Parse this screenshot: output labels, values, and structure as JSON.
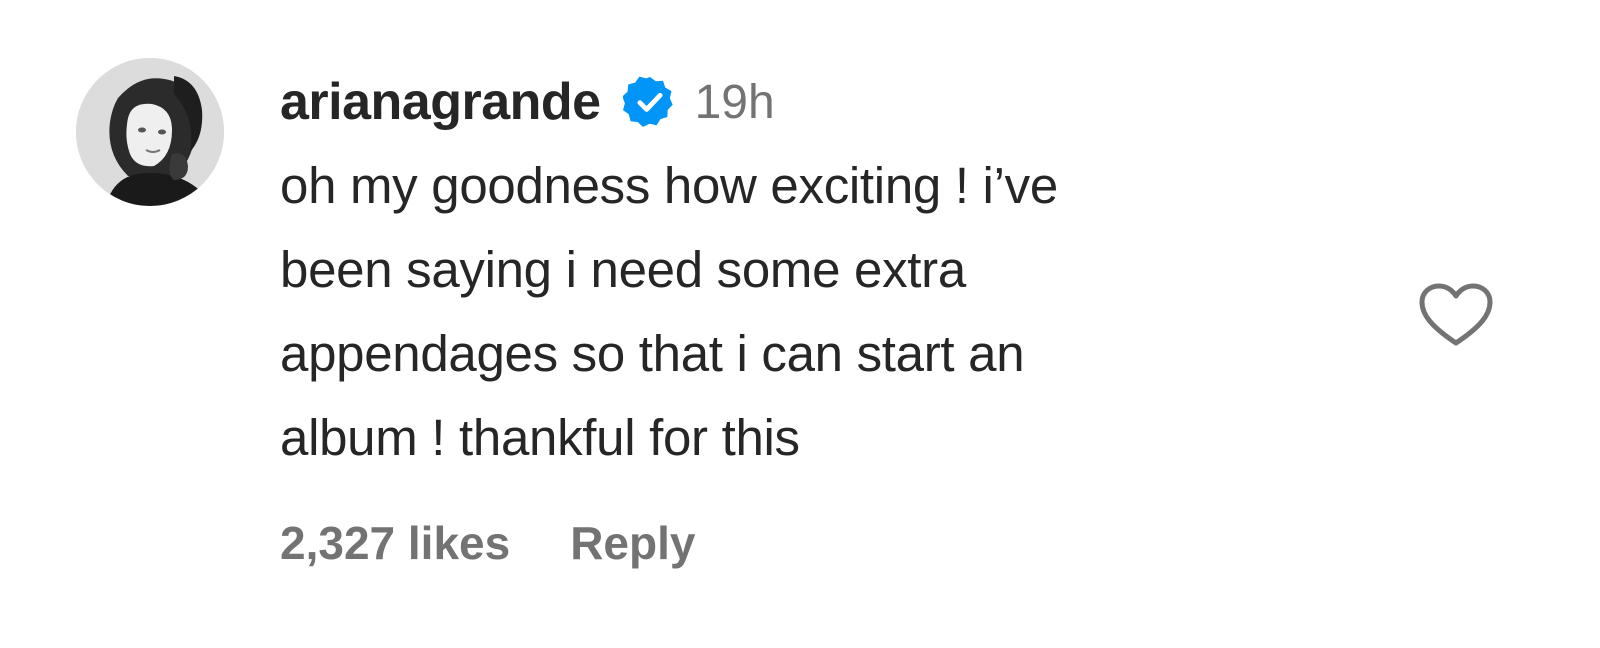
{
  "comment": {
    "username": "arianagrande",
    "time": "19h",
    "text": "oh my goodness how exciting ! i’ve\nbeen saying i need some extra\nappendages so that i can start an\nalbum ! thankful for this",
    "likes": "2,327 likes",
    "reply_label": "Reply"
  },
  "icons": {
    "avatar": "profile-photo",
    "verified": "verified-badge-icon",
    "like": "heart-outline-icon"
  },
  "colors": {
    "text": "#262626",
    "secondary": "#737373",
    "verified": "#0095f6"
  }
}
